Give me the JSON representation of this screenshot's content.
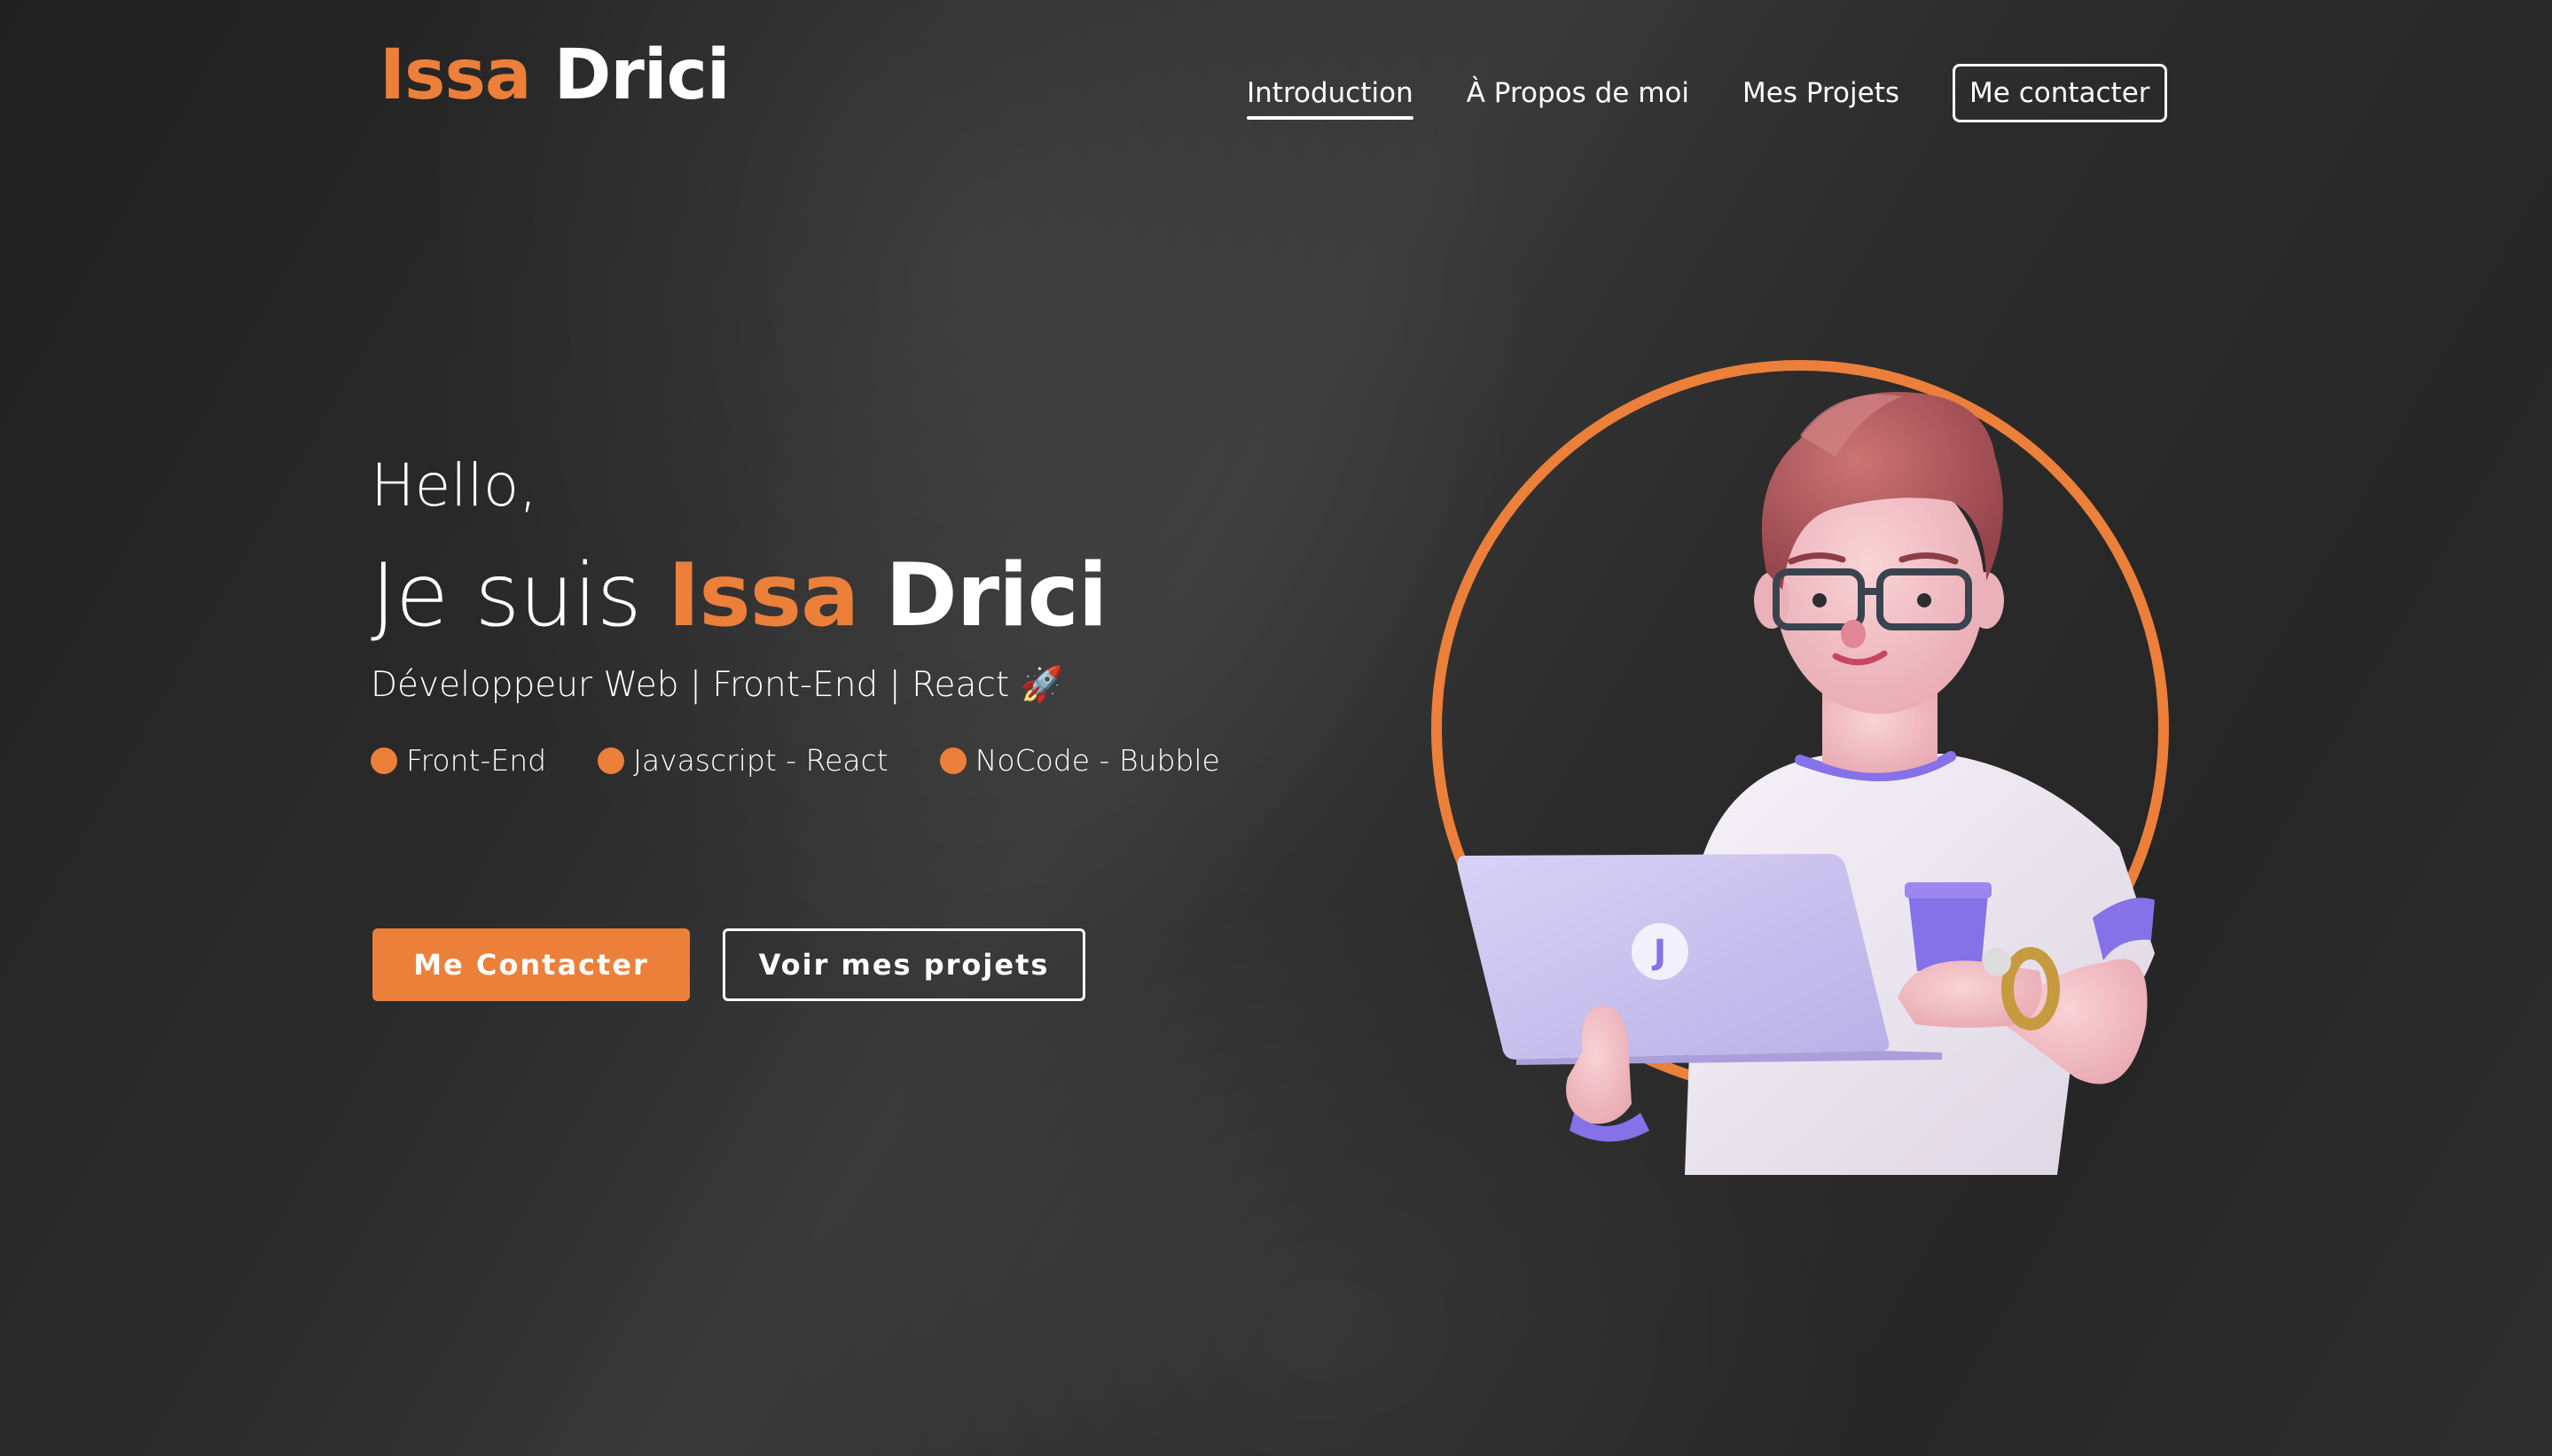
{
  "header": {
    "logo_first": "Issa",
    "logo_last": "Drici",
    "nav": [
      {
        "label": "Introduction",
        "active": true
      },
      {
        "label": "À Propos de moi",
        "active": false
      },
      {
        "label": "Mes Projets",
        "active": false
      }
    ],
    "contact_button": "Me contacter"
  },
  "hero": {
    "greeting": "Hello,",
    "intro": "Je suis",
    "first_name": "Issa",
    "last_name": "Drici",
    "role": "Développeur Web | Front-End | React 🚀",
    "skills": [
      "Front-End",
      "Javascript - React",
      "NoCode - Bubble"
    ],
    "primary_button": "Me Contacter",
    "secondary_button": "Voir mes projets"
  },
  "colors": {
    "accent": "#ec7f3a",
    "background": "#2b2b2b",
    "text": "#ffffff",
    "laptop": "#c9c1ef",
    "shirt": "#efeaf3",
    "sleeve_band": "#8571e8",
    "hair": "#b95d5e",
    "skin": "#f3c6cb"
  },
  "illustration": {
    "laptop_logo": "J"
  }
}
